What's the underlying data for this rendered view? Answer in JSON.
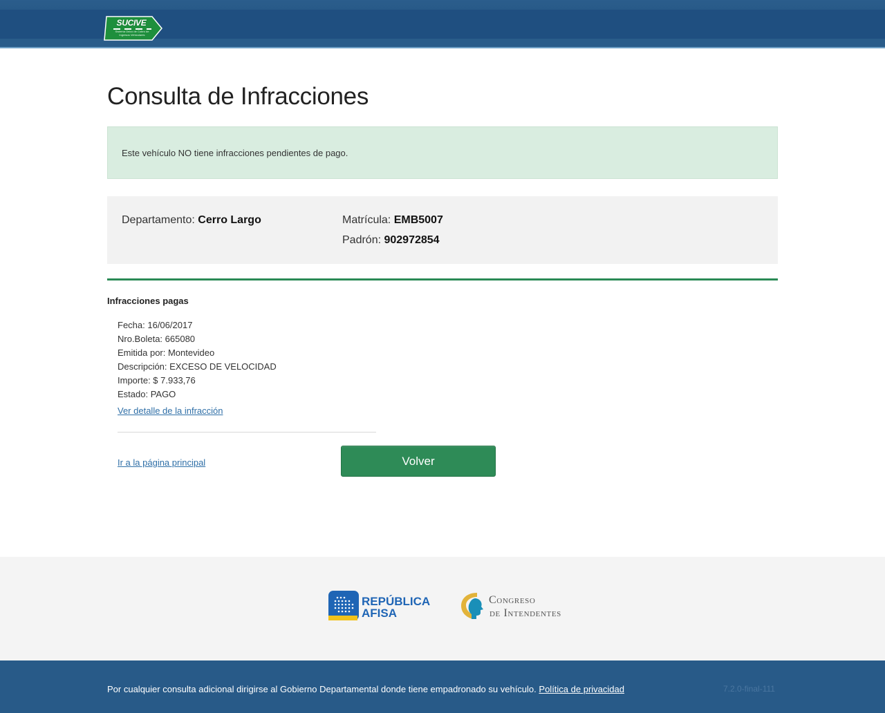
{
  "header": {
    "logo_text": "SUCIVE",
    "logo_subtext": "Sistema Único de Cobro de Ingresos Vehiculares"
  },
  "page_title": "Consulta de Infracciones",
  "alert": {
    "message": "Este vehículo NO tiene infracciones pendientes de pago.",
    "color": "#d9ede0"
  },
  "vehicle": {
    "departamento_label": "Departamento: ",
    "departamento_value": "Cerro Largo",
    "matricula_label": "Matrícula: ",
    "matricula_value": "EMB5007",
    "padron_label": "Padrón: ",
    "padron_value": "902972854"
  },
  "section_title": "Infracciones pagas",
  "infraction": {
    "fecha": "Fecha: 16/06/2017",
    "boleta": "Nro.Boleta: 665080",
    "emitida": "Emitida por: Montevideo",
    "descripcion": "Descripción: EXCESO DE VELOCIDAD",
    "importe": "Importe: $ 7.933,76",
    "estado": "Estado: PAGO",
    "detail_link": "Ver detalle de la infracción"
  },
  "actions": {
    "home_link": "Ir a la página principal",
    "back_button": "Volver"
  },
  "partners": {
    "republica_line1": "REPÚBLICA",
    "republica_line2": "AFISA",
    "congreso_line1": "Congreso",
    "congreso_line2": "de Intendentes"
  },
  "footer": {
    "text": "Por cualquier consulta adicional dirigirse al Gobierno Departamental donde tiene empadronado su vehículo.",
    "privacy_link": "Política de privacidad",
    "version": "7.2.0-final-111"
  },
  "colors": {
    "header_blue": "#1f4f80",
    "button_green": "#2e8b57",
    "link_blue": "#2f6fa7",
    "footer_blue": "#285a88"
  }
}
